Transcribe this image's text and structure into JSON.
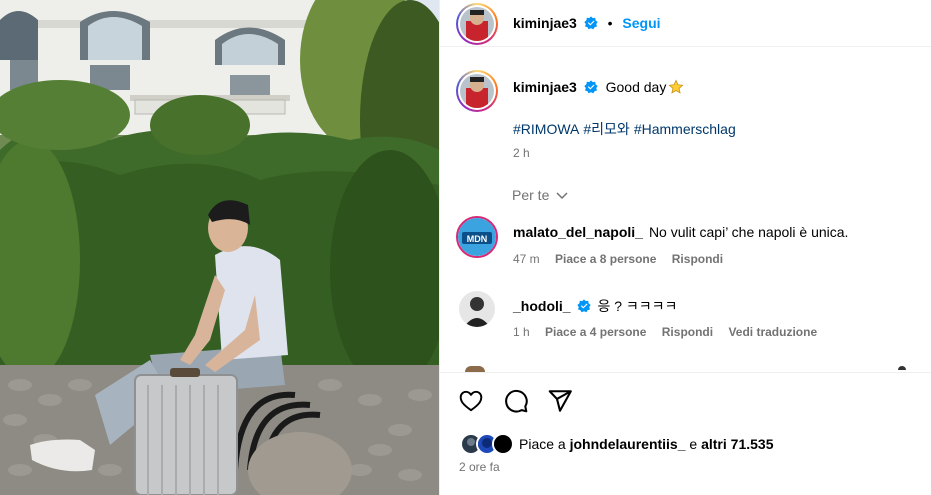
{
  "post": {
    "author": "kiminjae3",
    "dot": "•",
    "follow_label": "Segui",
    "caption_text": "Good day",
    "hashtags": [
      "#RIMOWA",
      "#리모와",
      "#Hammerschlag"
    ],
    "caption_time": "2 h"
  },
  "comments_filter": "Per te",
  "comments": [
    {
      "user": "malato_del_napoli_",
      "text": "No vulit capi’ che napoli è unica.",
      "time": "47 m",
      "likes": "Piace a 8 persone",
      "reply": "Rispondi",
      "avatar_label": "MDN"
    },
    {
      "user": "_hodoli_",
      "text": "응 ? ㅋㅋㅋㅋ",
      "time": "1 h",
      "likes": "Piace a 4 persone",
      "reply": "Rispondi",
      "translate": "Vedi traduzione"
    }
  ],
  "likes": {
    "prefix": "Piace a ",
    "user": "johndelaurentiis_",
    "middle": " e ",
    "others": "altri 71.535"
  },
  "post_time": "2 ore fa",
  "colors": {
    "link_blue": "#0095f6",
    "hashtag_blue": "#00376b",
    "secondary_text": "#737373",
    "verified_blue": "#0095f6"
  },
  "icons": [
    "heart-icon",
    "comment-icon",
    "share-icon",
    "verified-icon",
    "star-icon",
    "chevron-down-icon"
  ]
}
